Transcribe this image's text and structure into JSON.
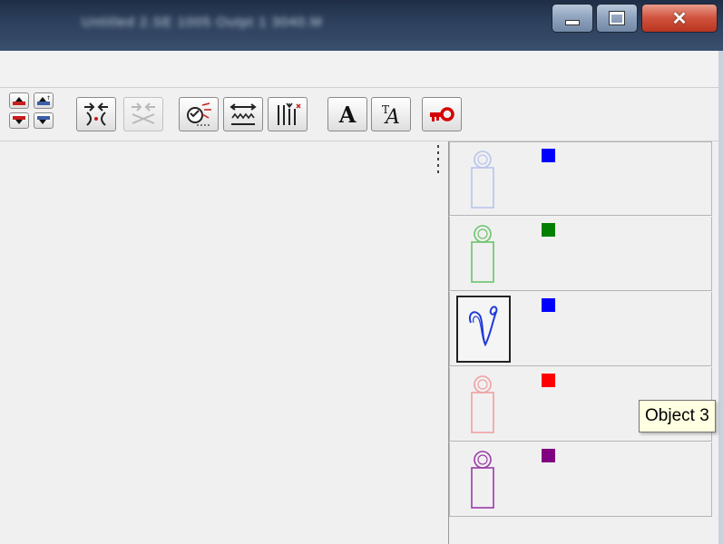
{
  "window": {
    "title": "Untitled 2.SE 1005 Outpt 1 3040.M",
    "controls": {
      "minimize": "minimize",
      "maximize": "maximize",
      "close": "✕"
    }
  },
  "toolbar": {
    "buttons": [
      {
        "name": "move-up-icon"
      },
      {
        "name": "move-to-top-icon"
      },
      {
        "name": "move-down-icon"
      },
      {
        "name": "move-to-bottom-icon"
      },
      {
        "name": "join-objects-icon"
      },
      {
        "name": "split-objects-icon",
        "disabled": true
      },
      {
        "name": "magic-wand-icon"
      },
      {
        "name": "stitch-width-icon"
      },
      {
        "name": "stitch-columns-icon"
      },
      {
        "name": "text-icon"
      },
      {
        "name": "text-edit-icon"
      },
      {
        "name": "lock-key-icon"
      }
    ],
    "text_glyph": "A"
  },
  "objects_panel": {
    "objects": [
      {
        "thumbnail": "tag-outline",
        "color": "#0000ff",
        "thumb_color": "#b9c4ee",
        "selected": false
      },
      {
        "thumbnail": "tag-outline",
        "color": "#007f00",
        "thumb_color": "#6cc46c",
        "selected": false
      },
      {
        "thumbnail": "script-letter-v",
        "color": "#0000ff",
        "thumb_color": "#1f3bd8",
        "selected": true
      },
      {
        "thumbnail": "tag-outline",
        "color": "#ff0000",
        "thumb_color": "#f0a0a0",
        "selected": false
      },
      {
        "thumbnail": "tag-outline",
        "color": "#800080",
        "thumb_color": "#9b3aa8",
        "selected": false
      }
    ]
  },
  "tooltip": {
    "text": "Object 3"
  }
}
